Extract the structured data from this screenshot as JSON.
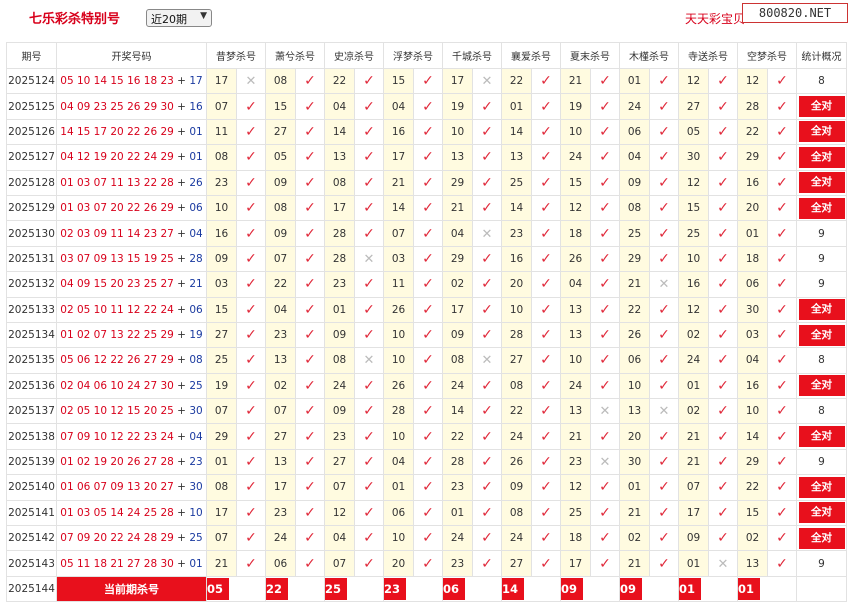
{
  "header": {
    "title": "七乐彩杀特别号",
    "period_select": "近20期",
    "brand": "天天彩宝贝",
    "watermark": "800820.NET"
  },
  "columns": [
    "期号",
    "开奖号码",
    "昔梦杀号",
    "萧兮杀号",
    "史凉杀号",
    "浮梦杀号",
    "千城杀号",
    "襄爱杀号",
    "夏末杀号",
    "木槿杀号",
    "寺送杀号",
    "空梦杀号",
    "统计概况"
  ],
  "all_label": "全对",
  "current_label": "当前期杀号",
  "rows": [
    {
      "issue": "2025124",
      "draw": "05 10 14 15 16 18 23",
      "special": "17",
      "predictions": [
        {
          "n": "17",
          "ok": false
        },
        {
          "n": "08",
          "ok": true
        },
        {
          "n": "22",
          "ok": true
        },
        {
          "n": "15",
          "ok": true
        },
        {
          "n": "17",
          "ok": false
        },
        {
          "n": "22",
          "ok": true
        },
        {
          "n": "21",
          "ok": true
        },
        {
          "n": "01",
          "ok": true
        },
        {
          "n": "12",
          "ok": true
        },
        {
          "n": "12",
          "ok": true
        }
      ],
      "stat": "8"
    },
    {
      "issue": "2025125",
      "draw": "04 09 23 25 26 29 30",
      "special": "16",
      "predictions": [
        {
          "n": "07",
          "ok": true
        },
        {
          "n": "15",
          "ok": true
        },
        {
          "n": "04",
          "ok": true
        },
        {
          "n": "04",
          "ok": true
        },
        {
          "n": "19",
          "ok": true
        },
        {
          "n": "01",
          "ok": true
        },
        {
          "n": "19",
          "ok": true
        },
        {
          "n": "24",
          "ok": true
        },
        {
          "n": "27",
          "ok": true
        },
        {
          "n": "28",
          "ok": true
        }
      ],
      "stat": "全对"
    },
    {
      "issue": "2025126",
      "draw": "14 15 17 20 22 26 29",
      "special": "01",
      "predictions": [
        {
          "n": "11",
          "ok": true
        },
        {
          "n": "27",
          "ok": true
        },
        {
          "n": "14",
          "ok": true
        },
        {
          "n": "16",
          "ok": true
        },
        {
          "n": "10",
          "ok": true
        },
        {
          "n": "14",
          "ok": true
        },
        {
          "n": "10",
          "ok": true
        },
        {
          "n": "06",
          "ok": true
        },
        {
          "n": "05",
          "ok": true
        },
        {
          "n": "22",
          "ok": true
        }
      ],
      "stat": "全对"
    },
    {
      "issue": "2025127",
      "draw": "04 12 19 20 22 24 29",
      "special": "01",
      "predictions": [
        {
          "n": "08",
          "ok": true
        },
        {
          "n": "05",
          "ok": true
        },
        {
          "n": "13",
          "ok": true
        },
        {
          "n": "17",
          "ok": true
        },
        {
          "n": "13",
          "ok": true
        },
        {
          "n": "13",
          "ok": true
        },
        {
          "n": "24",
          "ok": true
        },
        {
          "n": "04",
          "ok": true
        },
        {
          "n": "30",
          "ok": true
        },
        {
          "n": "29",
          "ok": true
        }
      ],
      "stat": "全对"
    },
    {
      "issue": "2025128",
      "draw": "01 03 07 11 13 22 28",
      "special": "26",
      "predictions": [
        {
          "n": "23",
          "ok": true
        },
        {
          "n": "09",
          "ok": true
        },
        {
          "n": "08",
          "ok": true
        },
        {
          "n": "21",
          "ok": true
        },
        {
          "n": "29",
          "ok": true
        },
        {
          "n": "25",
          "ok": true
        },
        {
          "n": "15",
          "ok": true
        },
        {
          "n": "09",
          "ok": true
        },
        {
          "n": "12",
          "ok": true
        },
        {
          "n": "16",
          "ok": true
        }
      ],
      "stat": "全对"
    },
    {
      "issue": "2025129",
      "draw": "01 03 07 20 22 26 29",
      "special": "06",
      "predictions": [
        {
          "n": "10",
          "ok": true
        },
        {
          "n": "08",
          "ok": true
        },
        {
          "n": "17",
          "ok": true
        },
        {
          "n": "14",
          "ok": true
        },
        {
          "n": "21",
          "ok": true
        },
        {
          "n": "14",
          "ok": true
        },
        {
          "n": "12",
          "ok": true
        },
        {
          "n": "08",
          "ok": true
        },
        {
          "n": "15",
          "ok": true
        },
        {
          "n": "20",
          "ok": true
        }
      ],
      "stat": "全对"
    },
    {
      "issue": "2025130",
      "draw": "02 03 09 11 14 23 27",
      "special": "04",
      "predictions": [
        {
          "n": "16",
          "ok": true
        },
        {
          "n": "09",
          "ok": true
        },
        {
          "n": "28",
          "ok": true
        },
        {
          "n": "07",
          "ok": true
        },
        {
          "n": "04",
          "ok": false
        },
        {
          "n": "23",
          "ok": true
        },
        {
          "n": "18",
          "ok": true
        },
        {
          "n": "25",
          "ok": true
        },
        {
          "n": "25",
          "ok": true
        },
        {
          "n": "01",
          "ok": true
        }
      ],
      "stat": "9"
    },
    {
      "issue": "2025131",
      "draw": "03 07 09 13 15 19 25",
      "special": "28",
      "predictions": [
        {
          "n": "09",
          "ok": true
        },
        {
          "n": "07",
          "ok": true
        },
        {
          "n": "28",
          "ok": false
        },
        {
          "n": "03",
          "ok": true
        },
        {
          "n": "29",
          "ok": true
        },
        {
          "n": "16",
          "ok": true
        },
        {
          "n": "26",
          "ok": true
        },
        {
          "n": "29",
          "ok": true
        },
        {
          "n": "10",
          "ok": true
        },
        {
          "n": "18",
          "ok": true
        }
      ],
      "stat": "9"
    },
    {
      "issue": "2025132",
      "draw": "04 09 15 20 23 25 27",
      "special": "21",
      "predictions": [
        {
          "n": "03",
          "ok": true
        },
        {
          "n": "22",
          "ok": true
        },
        {
          "n": "23",
          "ok": true
        },
        {
          "n": "11",
          "ok": true
        },
        {
          "n": "02",
          "ok": true
        },
        {
          "n": "20",
          "ok": true
        },
        {
          "n": "04",
          "ok": true
        },
        {
          "n": "21",
          "ok": false
        },
        {
          "n": "16",
          "ok": true
        },
        {
          "n": "06",
          "ok": true
        }
      ],
      "stat": "9"
    },
    {
      "issue": "2025133",
      "draw": "02 05 10 11 12 22 24",
      "special": "06",
      "predictions": [
        {
          "n": "15",
          "ok": true
        },
        {
          "n": "04",
          "ok": true
        },
        {
          "n": "01",
          "ok": true
        },
        {
          "n": "26",
          "ok": true
        },
        {
          "n": "17",
          "ok": true
        },
        {
          "n": "10",
          "ok": true
        },
        {
          "n": "13",
          "ok": true
        },
        {
          "n": "22",
          "ok": true
        },
        {
          "n": "12",
          "ok": true
        },
        {
          "n": "30",
          "ok": true
        }
      ],
      "stat": "全对"
    },
    {
      "issue": "2025134",
      "draw": "01 02 07 13 22 25 29",
      "special": "19",
      "predictions": [
        {
          "n": "27",
          "ok": true
        },
        {
          "n": "23",
          "ok": true
        },
        {
          "n": "09",
          "ok": true
        },
        {
          "n": "10",
          "ok": true
        },
        {
          "n": "09",
          "ok": true
        },
        {
          "n": "28",
          "ok": true
        },
        {
          "n": "13",
          "ok": true
        },
        {
          "n": "26",
          "ok": true
        },
        {
          "n": "02",
          "ok": true
        },
        {
          "n": "03",
          "ok": true
        }
      ],
      "stat": "全对"
    },
    {
      "issue": "2025135",
      "draw": "05 06 12 22 26 27 29",
      "special": "08",
      "predictions": [
        {
          "n": "25",
          "ok": true
        },
        {
          "n": "13",
          "ok": true
        },
        {
          "n": "08",
          "ok": false
        },
        {
          "n": "10",
          "ok": true
        },
        {
          "n": "08",
          "ok": false
        },
        {
          "n": "27",
          "ok": true
        },
        {
          "n": "10",
          "ok": true
        },
        {
          "n": "06",
          "ok": true
        },
        {
          "n": "24",
          "ok": true
        },
        {
          "n": "04",
          "ok": true
        }
      ],
      "stat": "8"
    },
    {
      "issue": "2025136",
      "draw": "02 04 06 10 24 27 30",
      "special": "25",
      "predictions": [
        {
          "n": "19",
          "ok": true
        },
        {
          "n": "02",
          "ok": true
        },
        {
          "n": "24",
          "ok": true
        },
        {
          "n": "26",
          "ok": true
        },
        {
          "n": "24",
          "ok": true
        },
        {
          "n": "08",
          "ok": true
        },
        {
          "n": "24",
          "ok": true
        },
        {
          "n": "10",
          "ok": true
        },
        {
          "n": "01",
          "ok": true
        },
        {
          "n": "16",
          "ok": true
        }
      ],
      "stat": "全对"
    },
    {
      "issue": "2025137",
      "draw": "02 05 10 12 15 20 25",
      "special": "30",
      "predictions": [
        {
          "n": "07",
          "ok": true
        },
        {
          "n": "07",
          "ok": true
        },
        {
          "n": "09",
          "ok": true
        },
        {
          "n": "28",
          "ok": true
        },
        {
          "n": "14",
          "ok": true
        },
        {
          "n": "22",
          "ok": true
        },
        {
          "n": "13",
          "ok": false
        },
        {
          "n": "13",
          "ok": false
        },
        {
          "n": "02",
          "ok": true
        },
        {
          "n": "10",
          "ok": true
        }
      ],
      "stat": "8"
    },
    {
      "issue": "2025138",
      "draw": "07 09 10 12 22 23 24",
      "special": "04",
      "predictions": [
        {
          "n": "29",
          "ok": true
        },
        {
          "n": "27",
          "ok": true
        },
        {
          "n": "23",
          "ok": true
        },
        {
          "n": "10",
          "ok": true
        },
        {
          "n": "22",
          "ok": true
        },
        {
          "n": "24",
          "ok": true
        },
        {
          "n": "21",
          "ok": true
        },
        {
          "n": "20",
          "ok": true
        },
        {
          "n": "21",
          "ok": true
        },
        {
          "n": "14",
          "ok": true
        }
      ],
      "stat": "全对"
    },
    {
      "issue": "2025139",
      "draw": "01 02 19 20 26 27 28",
      "special": "23",
      "predictions": [
        {
          "n": "01",
          "ok": true
        },
        {
          "n": "13",
          "ok": true
        },
        {
          "n": "27",
          "ok": true
        },
        {
          "n": "04",
          "ok": true
        },
        {
          "n": "28",
          "ok": true
        },
        {
          "n": "26",
          "ok": true
        },
        {
          "n": "23",
          "ok": false
        },
        {
          "n": "30",
          "ok": true
        },
        {
          "n": "21",
          "ok": true
        },
        {
          "n": "29",
          "ok": true
        }
      ],
      "stat": "9"
    },
    {
      "issue": "2025140",
      "draw": "01 06 07 09 13 20 27",
      "special": "30",
      "predictions": [
        {
          "n": "08",
          "ok": true
        },
        {
          "n": "17",
          "ok": true
        },
        {
          "n": "07",
          "ok": true
        },
        {
          "n": "01",
          "ok": true
        },
        {
          "n": "23",
          "ok": true
        },
        {
          "n": "09",
          "ok": true
        },
        {
          "n": "12",
          "ok": true
        },
        {
          "n": "01",
          "ok": true
        },
        {
          "n": "07",
          "ok": true
        },
        {
          "n": "22",
          "ok": true
        }
      ],
      "stat": "全对"
    },
    {
      "issue": "2025141",
      "draw": "01 03 05 14 24 25 28",
      "special": "10",
      "predictions": [
        {
          "n": "17",
          "ok": true
        },
        {
          "n": "23",
          "ok": true
        },
        {
          "n": "12",
          "ok": true
        },
        {
          "n": "06",
          "ok": true
        },
        {
          "n": "01",
          "ok": true
        },
        {
          "n": "08",
          "ok": true
        },
        {
          "n": "25",
          "ok": true
        },
        {
          "n": "21",
          "ok": true
        },
        {
          "n": "17",
          "ok": true
        },
        {
          "n": "15",
          "ok": true
        }
      ],
      "stat": "全对"
    },
    {
      "issue": "2025142",
      "draw": "07 09 20 22 24 28 29",
      "special": "25",
      "predictions": [
        {
          "n": "07",
          "ok": true
        },
        {
          "n": "24",
          "ok": true
        },
        {
          "n": "04",
          "ok": true
        },
        {
          "n": "10",
          "ok": true
        },
        {
          "n": "24",
          "ok": true
        },
        {
          "n": "24",
          "ok": true
        },
        {
          "n": "18",
          "ok": true
        },
        {
          "n": "02",
          "ok": true
        },
        {
          "n": "09",
          "ok": true
        },
        {
          "n": "02",
          "ok": true
        }
      ],
      "stat": "全对"
    },
    {
      "issue": "2025143",
      "draw": "05 11 18 21 27 28 30",
      "special": "01",
      "predictions": [
        {
          "n": "21",
          "ok": true
        },
        {
          "n": "06",
          "ok": true
        },
        {
          "n": "07",
          "ok": true
        },
        {
          "n": "20",
          "ok": true
        },
        {
          "n": "23",
          "ok": true
        },
        {
          "n": "27",
          "ok": true
        },
        {
          "n": "17",
          "ok": true
        },
        {
          "n": "21",
          "ok": true
        },
        {
          "n": "01",
          "ok": false
        },
        {
          "n": "13",
          "ok": true
        }
      ],
      "stat": "9"
    }
  ],
  "current": {
    "issue": "2025144",
    "kills": [
      "05",
      "22",
      "25",
      "23",
      "06",
      "14",
      "09",
      "09",
      "01",
      "01"
    ]
  }
}
